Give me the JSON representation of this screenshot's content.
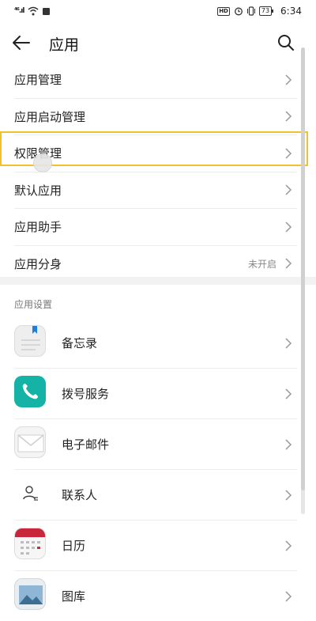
{
  "status_bar": {
    "signal": "⁴⁶.ıl",
    "time": "6:34",
    "hd": "HD",
    "battery": "73"
  },
  "header": {
    "title": "应用",
    "back_icon": "back-arrow-icon",
    "search_icon": "search-icon"
  },
  "menu": {
    "items": [
      {
        "label": "应用管理",
        "value": ""
      },
      {
        "label": "应用启动管理",
        "value": ""
      },
      {
        "label": "权限管理",
        "value": ""
      },
      {
        "label": "默认应用",
        "value": ""
      },
      {
        "label": "应用助手",
        "value": ""
      },
      {
        "label": "应用分身",
        "value": "未开启"
      }
    ]
  },
  "app_settings": {
    "header": "应用设置",
    "apps": [
      {
        "label": "备忘录",
        "icon": "memo-icon"
      },
      {
        "label": "拨号服务",
        "icon": "phone-icon"
      },
      {
        "label": "电子邮件",
        "icon": "email-icon"
      },
      {
        "label": "联系人",
        "icon": "contacts-icon"
      },
      {
        "label": "日历",
        "icon": "calendar-icon"
      },
      {
        "label": "图库",
        "icon": "gallery-icon"
      }
    ]
  },
  "colors": {
    "highlight": "#f2c12e",
    "phone_icon_bg": "#14b3a6",
    "calendar_red": "#c8263a"
  }
}
